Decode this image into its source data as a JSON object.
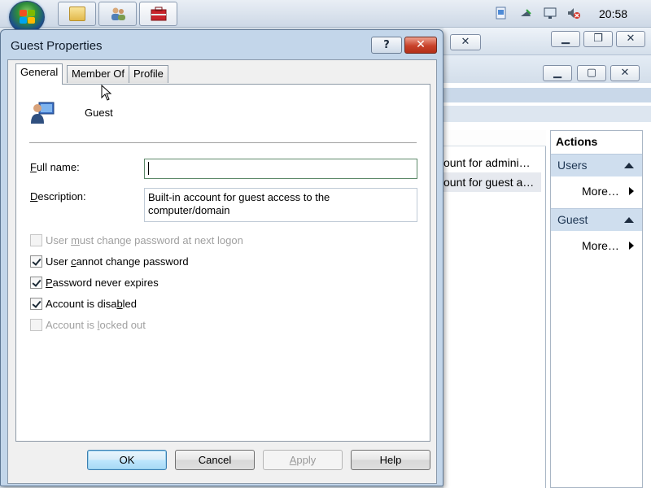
{
  "taskbar": {
    "clock": "20:58",
    "buttons": [
      {
        "name": "explorer-taskbar-button",
        "icon": "folder-icon"
      },
      {
        "name": "users-taskbar-button",
        "icon": "users-icon"
      },
      {
        "name": "toolbox-taskbar-button",
        "icon": "toolbox-icon"
      }
    ]
  },
  "background_window": {
    "list_rows": [
      "ount for admini…",
      "ount for guest a…"
    ],
    "actions": {
      "title": "Actions",
      "sections": [
        {
          "label": "Users",
          "more": "More…"
        },
        {
          "label": "Guest",
          "more": "More…"
        }
      ]
    }
  },
  "dialog": {
    "title": "Guest Properties",
    "help_glyph": "?",
    "close_glyph": "✕",
    "tabs": [
      "General",
      "Member Of",
      "Profile"
    ],
    "active_tab": "General",
    "user_name": "Guest",
    "full_name": {
      "label_prefix": "",
      "label_mnemonic": "F",
      "label_rest": "ull name:",
      "value": ""
    },
    "description": {
      "label_prefix": "",
      "label_mnemonic": "D",
      "label_rest": "escription:",
      "value": "Built-in account for guest access to the computer/domain"
    },
    "checkboxes": [
      {
        "prefix": "User ",
        "mnemonic": "m",
        "rest": "ust change password at next logon",
        "checked": false,
        "enabled": false
      },
      {
        "prefix": "User ",
        "mnemonic": "c",
        "rest": "annot change password",
        "checked": true,
        "enabled": true
      },
      {
        "prefix": "",
        "mnemonic": "P",
        "rest": "assword never expires",
        "checked": true,
        "enabled": true
      },
      {
        "prefix": "Account is disa",
        "mnemonic": "b",
        "rest": "led",
        "checked": true,
        "enabled": true
      },
      {
        "prefix": "Account is ",
        "mnemonic": "l",
        "rest": "ocked out",
        "checked": false,
        "enabled": false
      }
    ],
    "buttons": {
      "ok": "OK",
      "cancel": "Cancel",
      "apply_mnemonic": "A",
      "apply_rest": "pply",
      "help": "Help"
    }
  },
  "colors": {
    "dialog_frame": "#c3d6ea",
    "close_button": "#c8412a",
    "actions_section": "#cfdeee"
  }
}
